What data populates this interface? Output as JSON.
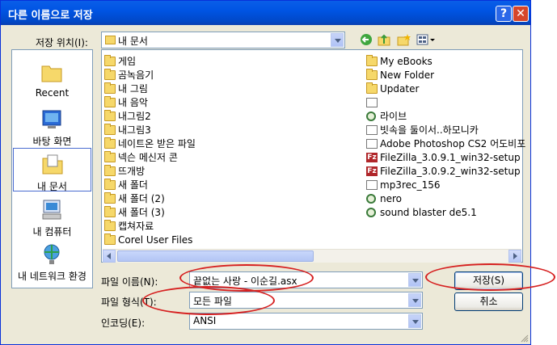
{
  "window": {
    "title": "다른 이름으로 저장",
    "help_glyph": "?",
    "close_glyph": "✕"
  },
  "save_in": {
    "label": "저장 위치(I):",
    "value": "내 문서"
  },
  "places": [
    {
      "label": "Recent",
      "icon": "recent-folder-icon"
    },
    {
      "label": "바탕 화면",
      "icon": "desktop-icon"
    },
    {
      "label": "내 문서",
      "icon": "my-documents-icon"
    },
    {
      "label": "내 컴퓨터",
      "icon": "my-computer-icon"
    },
    {
      "label": "내 네트워크 환경",
      "icon": "network-icon"
    }
  ],
  "files_left": [
    "게임",
    "곰녹음기",
    "내 그림",
    "내 음악",
    "내그림2",
    "내그림3",
    "네이트온 받은 파일",
    "넥슨 메신저 콘",
    "뜨개방",
    "새 폴더",
    "새 폴더 (2)",
    "새 폴더 (3)",
    "캡쳐자료",
    "Corel User Files"
  ],
  "files_right": [
    "My eBooks",
    "New Folder",
    "Updater",
    "",
    "라이브",
    "빗속을 둘이서..하모니카",
    "Adobe Photoshop CS2 어도비포",
    "FileZilla_3.0.9.1_win32-setup",
    "FileZilla_3.0.9.2_win32-setup",
    "mp3rec_156",
    "nero",
    "sound blaster de5.1"
  ],
  "file_name": {
    "label": "파일 이름(N):",
    "value": "끝없는 사랑 - 이순길.asx"
  },
  "file_type": {
    "label": "파일 형식(T):",
    "value": "모든 파일"
  },
  "encoding": {
    "label": "인코딩(E):",
    "value": "ANSI"
  },
  "buttons": {
    "save": "저장(S)",
    "cancel": "취소"
  },
  "annotation_color": "#d62020"
}
